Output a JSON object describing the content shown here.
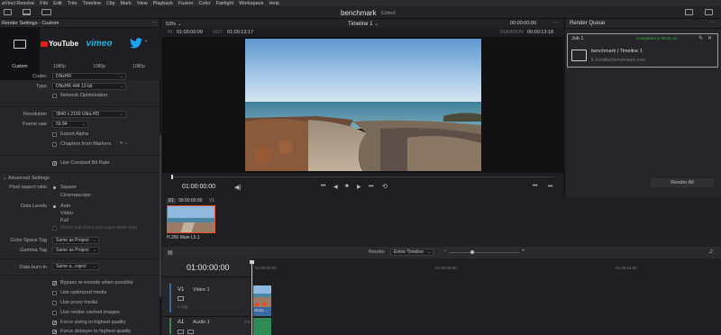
{
  "menu": [
    "aVinci Resolve",
    "File",
    "Edit",
    "Trim",
    "Timeline",
    "Clip",
    "Mark",
    "View",
    "Playback",
    "Fusion",
    "Color",
    "Fairlight",
    "Workspace",
    "Help"
  ],
  "project": {
    "title": "benchmark",
    "status": "Edited"
  },
  "render_settings": {
    "title": "Render Settings - Custom",
    "presets": [
      {
        "label": "Custom",
        "logo": "custom-preset-icon"
      },
      {
        "label": "1080p",
        "logo": "YouTube"
      },
      {
        "label": "1080p",
        "logo": "vimeo"
      },
      {
        "label": "1080p",
        "logo": "twitter-bird-icon"
      }
    ],
    "codec": {
      "label": "Codec",
      "value": "DNxHR"
    },
    "type": {
      "label": "Type",
      "value": "DNxHR 444 12-bit"
    },
    "network_optimization": "Network Optimization",
    "resolution": {
      "label": "Resolution",
      "value": "3840 x 2160 Ultra HD"
    },
    "frame_rate": {
      "label": "Frame rate",
      "value": "59.94"
    },
    "export_alpha": "Export Alpha",
    "chapters": "Chapters from Markers",
    "constant_bitrate": "Use Constant Bit Rate",
    "advanced": "Advanced Settings",
    "pixel_aspect": {
      "label": "Pixel aspect ratio",
      "opt1": "Square",
      "opt2": "Cinemascope"
    },
    "data_levels": {
      "label": "Data Levels",
      "opt1": "Auto",
      "opt2": "Video",
      "opt3": "Full",
      "extra": "Retain sub-black and super-white data"
    },
    "color_space_tag": {
      "label": "Color Space Tag",
      "value": "Same as Project"
    },
    "gamma_tag": {
      "label": "Gamma Tag",
      "value": "Same as Project"
    },
    "data_burn_in": {
      "label": "Data burn-in",
      "value": "Same a...roject"
    },
    "checks": [
      {
        "label": "Bypass re-encode when possible",
        "on": true
      },
      {
        "label": "Use optimized media",
        "on": false
      },
      {
        "label": "Use proxy media",
        "on": false
      },
      {
        "label": "Use render cached images",
        "on": false
      },
      {
        "label": "Force sizing to highest quality",
        "on": true
      },
      {
        "label": "Force debayer to highest quality",
        "on": true
      }
    ]
  },
  "viewer": {
    "zoom": "53%",
    "timeline_name": "Timeline 1",
    "top_timecode": "00:00:00:00",
    "in_label": "IN",
    "in_tc": "01:00:00:00",
    "out_label": "OUT",
    "out_tc": "01:00:13:17",
    "duration_label": "DURATION",
    "duration_tc": "00:00:13:18",
    "playhead_tc": "01:00:00:00"
  },
  "render_queue": {
    "title": "Render Queue",
    "job_label": "Job 1",
    "job_status": "Completed in 00:01:41",
    "job_name": "benchmark | Timeline 1",
    "job_path": "E:\\Untitled\\benchmark.mov",
    "render_all": "Render All"
  },
  "media": {
    "clip_num": "01",
    "clip_tc": "00:00:00:00",
    "clip_track": "V1",
    "clip_codec": "H.265 Main L5.1"
  },
  "timeline": {
    "timecode": "01:00:00:00",
    "render_label": "Render",
    "render_value": "Entire Timeline",
    "ruler": [
      "01:00:00:00",
      "01:00:08:00",
      "01:00:16:00"
    ],
    "v1": "V1",
    "v1_name": "Video 1",
    "v1_count": "1 Clip",
    "a1": "A1",
    "a1_name": "Audio 1",
    "a1_ch": "2.0",
    "clip_label": "2019..."
  },
  "colors": {
    "accent_green": "#3cb04a",
    "youtube_red": "#e62117",
    "vimeo_blue": "#1ab7ea",
    "twitter_blue": "#1da1f2",
    "audio_green": "#2f8a55"
  }
}
